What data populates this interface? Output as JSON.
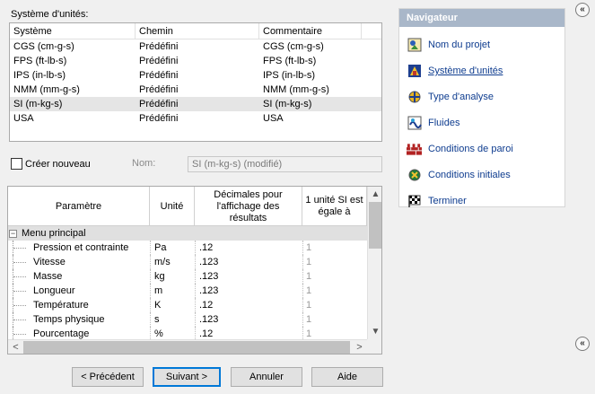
{
  "systems": {
    "label": "Système d'unités:",
    "columns": [
      "Système",
      "Chemin",
      "Commentaire"
    ],
    "rows": [
      [
        "CGS (cm-g-s)",
        "Prédéfini",
        "CGS (cm-g-s)"
      ],
      [
        "FPS (ft-lb-s)",
        "Prédéfini",
        "FPS (ft-lb-s)"
      ],
      [
        "IPS (in-lb-s)",
        "Prédéfini",
        "IPS (in-lb-s)"
      ],
      [
        "NMM (mm-g-s)",
        "Prédéfini",
        "NMM (mm-g-s)"
      ],
      [
        "SI (m-kg-s)",
        "Prédéfini",
        "SI (m-kg-s)"
      ],
      [
        "USA",
        "Prédéfini",
        "USA"
      ]
    ],
    "selected_index": 4
  },
  "create_new": {
    "label": "Créer nouveau",
    "checked": false,
    "name_label": "Nom:",
    "name_value": "SI (m-kg-s) (modifié)"
  },
  "params": {
    "headers": [
      "Paramètre",
      "Unité",
      "Décimales pour l'affichage des résultats",
      "1 unité SI est égale à"
    ],
    "group": "Menu principal",
    "rows": [
      [
        "Pression et contrainte",
        "Pa",
        ".12",
        "1"
      ],
      [
        "Vitesse",
        "m/s",
        ".123",
        "1"
      ],
      [
        "Masse",
        "kg",
        ".123",
        "1"
      ],
      [
        "Longueur",
        "m",
        ".123",
        "1"
      ],
      [
        "Température",
        "K",
        ".12",
        "1"
      ],
      [
        "Temps physique",
        "s",
        ".123",
        "1"
      ],
      [
        "Pourcentage",
        "%",
        ".12",
        "1"
      ]
    ]
  },
  "buttons": {
    "prev": "< Précédent",
    "next": "Suivant >",
    "cancel": "Annuler",
    "help": "Aide"
  },
  "navigator": {
    "title": "Navigateur",
    "items": [
      {
        "label": "Nom du projet",
        "icon": "project-name-icon",
        "active": false
      },
      {
        "label": "Système d'unités",
        "icon": "unit-system-icon",
        "active": true
      },
      {
        "label": "Type d'analyse",
        "icon": "analysis-type-icon",
        "active": false
      },
      {
        "label": "Fluides",
        "icon": "fluids-icon",
        "active": false
      },
      {
        "label": "Conditions de paroi",
        "icon": "wall-conditions-icon",
        "active": false
      },
      {
        "label": "Conditions initiales",
        "icon": "initial-conditions-icon",
        "active": false
      },
      {
        "label": "Terminer",
        "icon": "finish-flag-icon",
        "active": false
      }
    ]
  },
  "collapse": {
    "top_glyph": "«",
    "bottom_glyph": "«"
  },
  "arrows": {
    "up": "▲",
    "down": "▼",
    "left": "<",
    "right": ">",
    "expand": "−"
  }
}
